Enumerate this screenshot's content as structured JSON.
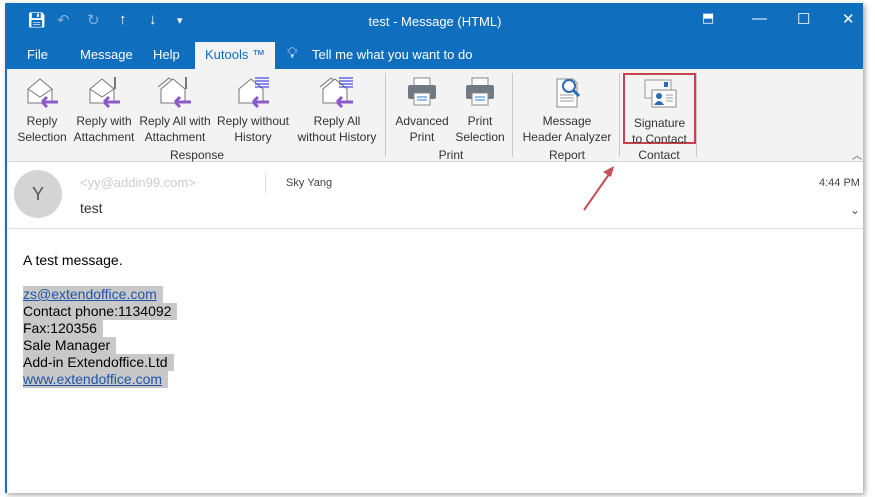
{
  "window": {
    "title": "test  -  Message (HTML)"
  },
  "tabs": [
    "File",
    "Message",
    "Help",
    "Kutools ™"
  ],
  "tell_me": "Tell me what you want to do",
  "ribbon": {
    "groups": [
      {
        "label": "Response",
        "buttons": [
          [
            "Reply",
            "Selection"
          ],
          [
            "Reply with",
            "Attachment"
          ],
          [
            "Reply All with",
            "Attachment"
          ],
          [
            "Reply without",
            "History"
          ],
          [
            "Reply All",
            "without History"
          ]
        ]
      },
      {
        "label": "Print",
        "buttons": [
          [
            "Advanced",
            "Print"
          ],
          [
            "Print",
            "Selection"
          ]
        ]
      },
      {
        "label": "Report",
        "buttons": [
          [
            "Message",
            "Header Analyzer"
          ]
        ]
      },
      {
        "label": "Contact",
        "buttons": [
          [
            "Signature",
            "to Contact"
          ]
        ]
      }
    ]
  },
  "message": {
    "avatar": "Y",
    "from": "<yy@addin99.com>",
    "to": "Sky Yang",
    "time": "4:44 PM",
    "subject": "test"
  },
  "body": {
    "intro": "A test message.",
    "lines": [
      "zs@extendoffice.com",
      "Contact phone:1134092",
      "Fax:120356",
      "Sale Manager",
      "Add-in Extendoffice.Ltd",
      "www.extendoffice.com"
    ]
  },
  "colors": {
    "brand": "#106ebe",
    "highlight": "#c8414b"
  }
}
